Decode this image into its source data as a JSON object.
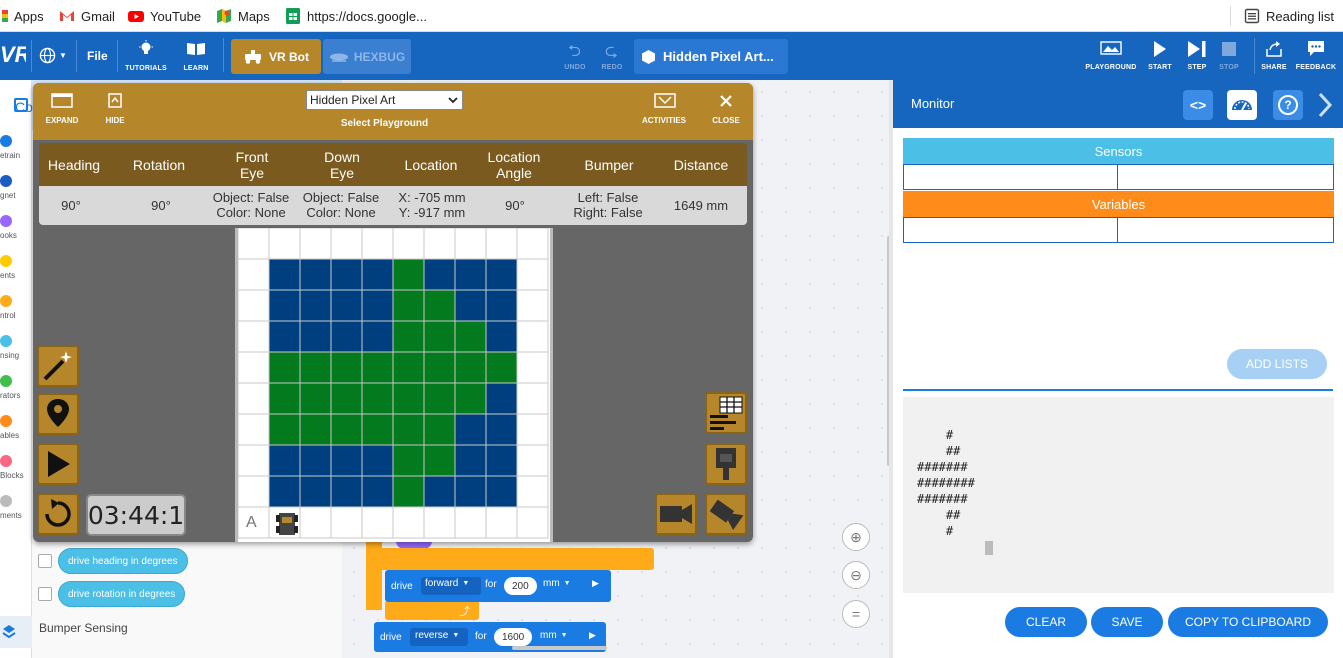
{
  "bookmarks": {
    "apps": "Apps",
    "gmail": "Gmail",
    "youtube": "YouTube",
    "maps": "Maps",
    "docs": "https://docs.google...",
    "reading_list": "Reading list"
  },
  "topbar": {
    "logo": "VR",
    "file": "File",
    "tutorials": "TUTORIALS",
    "learn": "LEARN",
    "vrbot": "VR Bot",
    "hexbug": "HEXBUG",
    "undo": "UNDO",
    "redo": "REDO",
    "project_title": "Hidden Pixel Art...",
    "playground": "PLAYGROUND",
    "start": "START",
    "step": "STEP",
    "stop": "STOP",
    "share": "SHARE",
    "feedback": "FEEDBACK"
  },
  "categories": [
    {
      "label": "Drivetrain",
      "shown": "etrain",
      "color": "#1a7be3"
    },
    {
      "label": "Magnet",
      "shown": "gnet",
      "color": "#1a5cbf"
    },
    {
      "label": "Looks",
      "shown": "ooks",
      "color": "#9966ff"
    },
    {
      "label": "Events",
      "shown": "ents",
      "color": "#ffcc00"
    },
    {
      "label": "Control",
      "shown": "ntrol",
      "color": "#ffab19"
    },
    {
      "label": "Sensing",
      "shown": "nsing",
      "color": "#4cbfe6"
    },
    {
      "label": "Operators",
      "shown": "rators",
      "color": "#40bf4a"
    },
    {
      "label": "Variables",
      "shown": "ables",
      "color": "#ff8c1a"
    },
    {
      "label": "My Blocks",
      "shown": "Blocks",
      "color": "#ff6680"
    },
    {
      "label": "Comments",
      "shown": "ments",
      "color": "#bbbbbb"
    }
  ],
  "palette": {
    "header_partial": "Co",
    "block_heading": "drive heading in degrees",
    "block_rotation": "drive rotation in degrees",
    "bumper_sensing": "Bumper Sensing"
  },
  "playground": {
    "expand": "EXPAND",
    "hide": "HIDE",
    "select_value": "Hidden Pixel Art",
    "select_label": "Select Playground",
    "activities": "ACTIVITIES",
    "close": "CLOSE",
    "headers": {
      "heading": "Heading",
      "rotation": "Rotation",
      "front_eye_1": "Front",
      "front_eye_2": "Eye",
      "down_eye_1": "Down",
      "down_eye_2": "Eye",
      "location": "Location",
      "location_angle_1": "Location",
      "location_angle_2": "Angle",
      "bumper": "Bumper",
      "distance": "Distance"
    },
    "values": {
      "heading": "90°",
      "rotation": "90°",
      "front_eye_1": "Object: False",
      "front_eye_2": "Color: None",
      "down_eye_1": "Object: False",
      "down_eye_2": "Color: None",
      "location_1": "X: -705 mm",
      "location_2": "Y: -917 mm",
      "location_angle": "90°",
      "bumper_1": "Left: False",
      "bumper_2": "Right: False",
      "distance": "1649 mm"
    },
    "field_label": "A",
    "timer": "03:44:1",
    "colors": {
      "blue": "#003f7f",
      "green": "#047a1e",
      "gold": "#b5862a"
    }
  },
  "workspace_blocks": {
    "drive": "drive",
    "forward": "forward",
    "for": "for",
    "forward_value": "200",
    "unit": "mm",
    "reverse": "reverse",
    "reverse_value": "1600"
  },
  "monitor": {
    "title": "Monitor",
    "sensors": "Sensors",
    "variables": "Variables",
    "add_lists": "ADD LISTS",
    "console_lines": [
      "    #",
      "    ##",
      "#######",
      "########",
      "#######",
      "    ##",
      "    #"
    ],
    "clear": "CLEAR",
    "save": "SAVE",
    "copy": "COPY TO CLIPBOARD"
  }
}
